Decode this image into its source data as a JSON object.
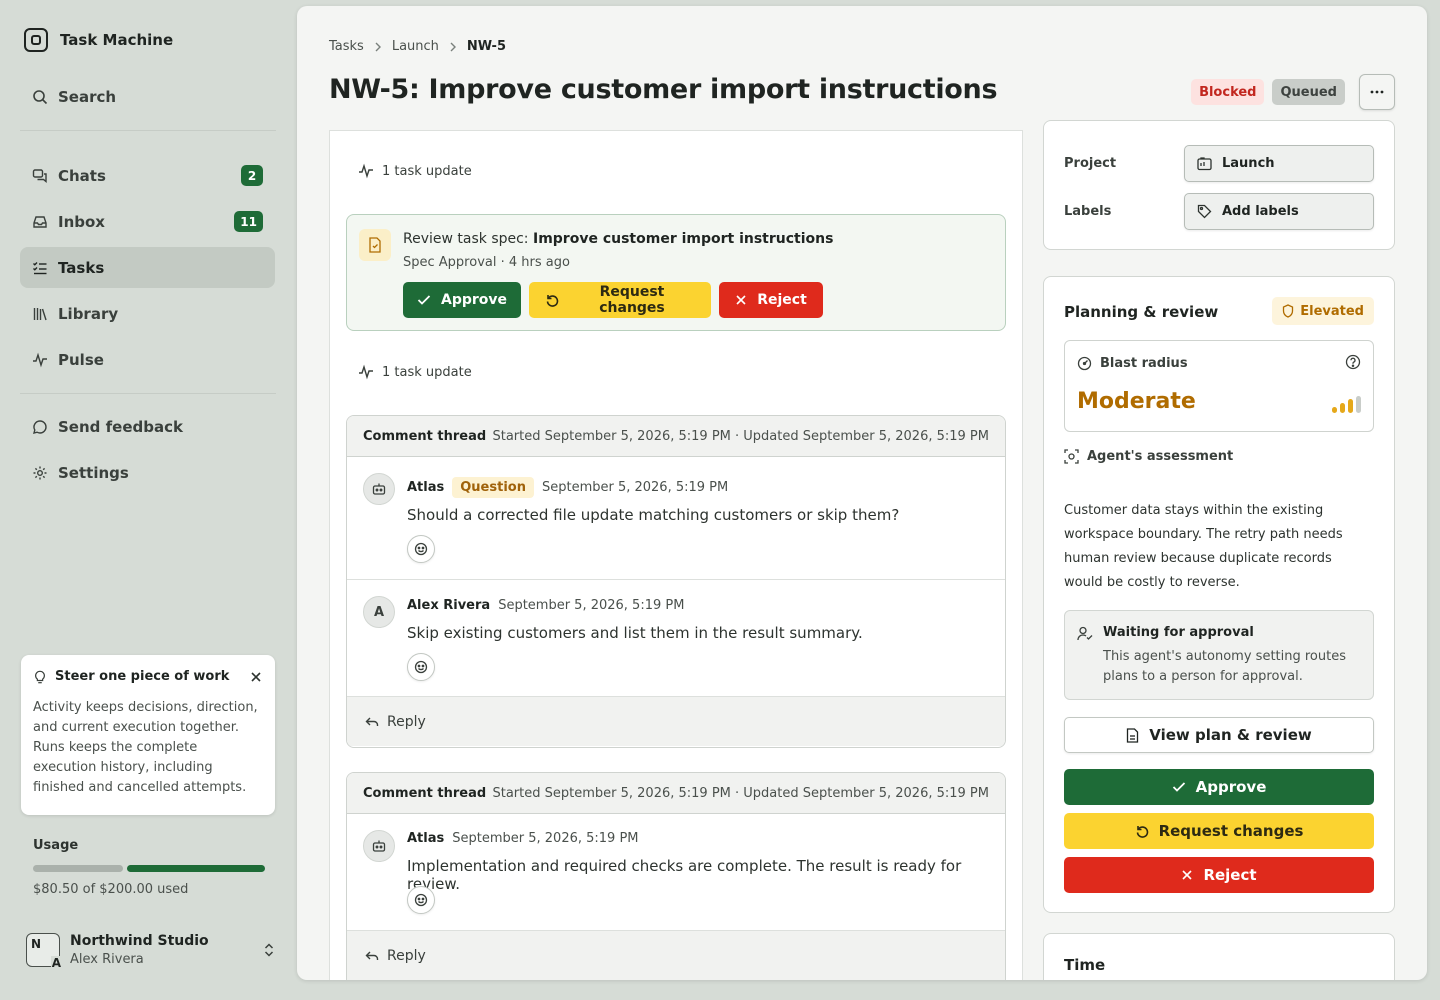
{
  "app": {
    "name": "Task Machine"
  },
  "sidebar": {
    "search_label": "Search",
    "items": [
      {
        "label": "Chats",
        "badge": "2",
        "icon": "chats-icon"
      },
      {
        "label": "Inbox",
        "badge": "11",
        "icon": "inbox-icon"
      },
      {
        "label": "Tasks",
        "badge": "",
        "icon": "tasks-icon",
        "active": true
      },
      {
        "label": "Library",
        "badge": "",
        "icon": "library-icon"
      },
      {
        "label": "Pulse",
        "badge": "",
        "icon": "pulse-icon"
      }
    ],
    "feedback_label": "Send feedback",
    "settings_label": "Settings",
    "tip": {
      "title": "Steer one piece of work",
      "body": "Activity keeps decisions, direction, and current execution together. Runs keeps the complete execution history, including finished and cancelled attempts."
    },
    "usage": {
      "title": "Usage",
      "text": "$80.50 of $200.00 used",
      "fraction": 0.4025
    },
    "workspace": {
      "name": "Northwind Studio",
      "user": "Alex Rivera",
      "initial_1": "N",
      "initial_2": "A"
    }
  },
  "header": {
    "breadcrumb": [
      "Tasks",
      "Launch",
      "NW-5"
    ],
    "title": "NW-5: Improve customer import instructions",
    "status_1": "Blocked",
    "status_2": "Queued"
  },
  "activity": {
    "update_1": "1 task update",
    "update_2": "1 task update",
    "spec": {
      "prefix": "Review task spec: ",
      "title": "Improve customer import instructions",
      "sub": "Spec Approval · 4 hrs ago",
      "approve": "Approve",
      "request": "Request changes",
      "reject": "Reject"
    },
    "threads": [
      {
        "title": "Comment thread",
        "meta": "Started September 5, 2026, 5:19 PM · Updated September 5, 2026, 5:19 PM",
        "comments": [
          {
            "author": "Atlas",
            "tag": "Question",
            "time": "September 5, 2026, 5:19 PM",
            "body": "Should a corrected file update matching customers or skip them?"
          },
          {
            "author": "Alex Rivera",
            "initial": "A",
            "time": "September 5, 2026, 5:19 PM",
            "body": "Skip existing customers and list them in the result summary."
          }
        ],
        "reply": "Reply"
      },
      {
        "title": "Comment thread",
        "meta": "Started September 5, 2026, 5:19 PM · Updated September 5, 2026, 5:19 PM",
        "comments": [
          {
            "author": "Atlas",
            "time": "September 5, 2026, 5:19 PM",
            "body": "Implementation and required checks are complete. The result is ready for review."
          }
        ],
        "reply": "Reply"
      }
    ]
  },
  "properties": {
    "project_label": "Project",
    "project_value": "Launch",
    "labels_label": "Labels",
    "labels_value": "Add labels"
  },
  "planning": {
    "title": "Planning & review",
    "risk": "Elevated",
    "blast_label": "Blast radius",
    "blast_value": "Moderate",
    "blast_level": "3 of 4",
    "assessment_label": "Agent's assessment",
    "assessment": "Customer data stays within the existing workspace boundary. The retry path needs human review because duplicate records would be costly to reverse.",
    "waiting_title": "Waiting for approval",
    "waiting_body": "This agent's autonomy setting routes plans to a person for approval.",
    "view_plan": "View plan & review",
    "approve": "Approve",
    "request": "Request changes",
    "reject": "Reject"
  },
  "time_card": {
    "title": "Time"
  },
  "colors": {
    "accent_green": "#1e6b37",
    "warning_yellow": "#fbd330",
    "danger_red": "#df2a1c",
    "elevated": "#b06c00"
  }
}
